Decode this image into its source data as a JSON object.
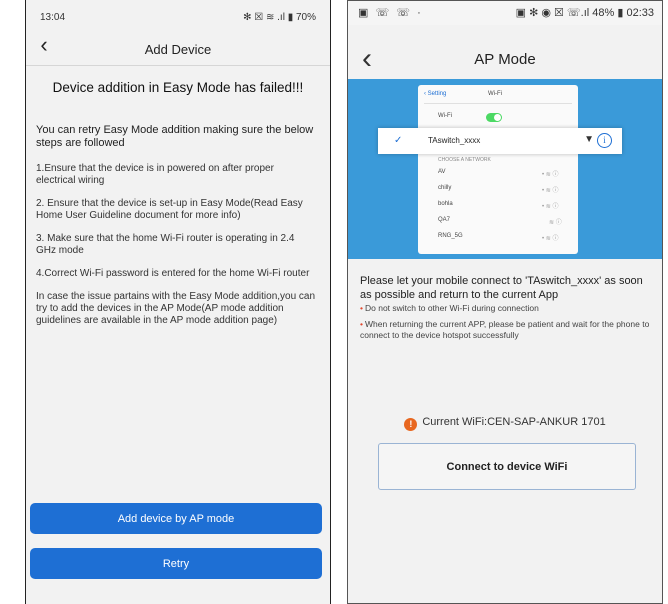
{
  "left": {
    "status": {
      "time": "13:04",
      "icons": "✻ ☒ ≋ .ıl ▮ 70%"
    },
    "header": {
      "back": "‹",
      "title": "Add Device"
    },
    "heading": "Device addition in Easy Mode has failed!!!",
    "intro": "You can retry Easy Mode addition making sure the below steps are followed",
    "steps": [
      "1.Ensure that the device is in powered on after proper electrical wiring",
      "2. Ensure that the device is set-up in Easy Mode(Read Easy Home User Guideline document for more info)",
      "3. Make sure that the home Wi-Fi router is operating in 2.4 GHz mode",
      "4.Correct Wi-Fi password is entered for the home Wi-Fi router",
      "In case the issue partains with the Easy Mode addition,you can try to add the devices in the AP Mode(AP mode addition guidelines are available in the AP mode addition page)"
    ],
    "buttons": {
      "ap_mode": "Add device by AP mode",
      "retry": "Retry"
    },
    "colors": {
      "button": "#1e6fd4"
    }
  },
  "right": {
    "status": {
      "icons": "▣ ☏ ☏ ·",
      "right": "▣ ✻ ◉ ☒ ☏.ıl 48% ▮ 02:33"
    },
    "header": {
      "back": "‹",
      "title": "AP Mode"
    },
    "illustration": {
      "back": "‹ Setting",
      "title": "Wi-Fi",
      "wifi_label": "Wi-Fi",
      "highlight_ssid": "TAswitch_xxxx",
      "section_label": "CHOOSE A NETWORK",
      "networks": [
        "AV",
        "chilly",
        "bohla",
        "QA7",
        "RNG_5G"
      ]
    },
    "message": "Please let your mobile connect to 'TAswitch_xxxx' as soon as possible and return to the current App",
    "bullets": [
      "Do not switch to other Wi-Fi during connection",
      "When returning the current APP, please be patient and wait for the phone to connect to the device hotspot successfully"
    ],
    "current_wifi": "Current WiFi:CEN-SAP-ANKUR 1701",
    "connect_button": "Connect to device WiFi",
    "colors": {
      "banner": "#3a9ad9",
      "warn": "#e8671f"
    }
  }
}
